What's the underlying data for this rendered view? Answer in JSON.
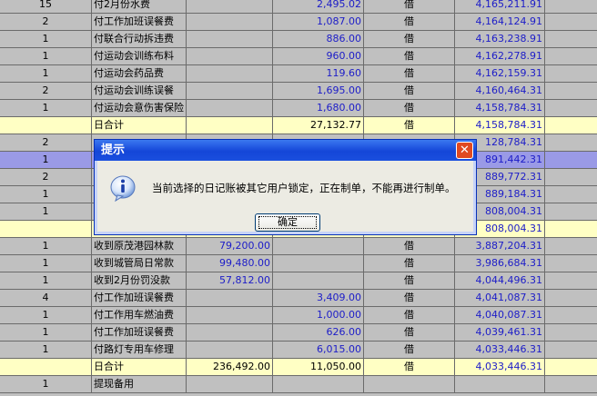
{
  "ledger": {
    "rows": [
      {
        "type": "normal",
        "count": "15",
        "summary": "付2月份水费",
        "debit": "",
        "credit": "2,495.02",
        "direction": "借",
        "balance": "4,165,211.91"
      },
      {
        "type": "normal",
        "count": "2",
        "summary": "付工作加班误餐费",
        "debit": "",
        "credit": "1,087.00",
        "direction": "借",
        "balance": "4,164,124.91"
      },
      {
        "type": "normal",
        "count": "1",
        "summary": "付联合行动拆违费",
        "debit": "",
        "credit": "886.00",
        "direction": "借",
        "balance": "4,163,238.91"
      },
      {
        "type": "normal",
        "count": "1",
        "summary": "付运动会训练布料",
        "debit": "",
        "credit": "960.00",
        "direction": "借",
        "balance": "4,162,278.91"
      },
      {
        "type": "normal",
        "count": "1",
        "summary": "付运动会药品费",
        "debit": "",
        "credit": "119.60",
        "direction": "借",
        "balance": "4,162,159.31"
      },
      {
        "type": "normal",
        "count": "2",
        "summary": "付运动会训练误餐",
        "debit": "",
        "credit": "1,695.00",
        "direction": "借",
        "balance": "4,160,464.31"
      },
      {
        "type": "normal",
        "count": "1",
        "summary": "付运动会意伤害保险",
        "debit": "",
        "credit": "1,680.00",
        "direction": "借",
        "balance": "4,158,784.31"
      },
      {
        "type": "total",
        "count": "",
        "summary": "日合计",
        "debit": "",
        "credit": "27,132.77",
        "direction": "借",
        "balance": "4,158,784.31"
      },
      {
        "type": "normal",
        "count": "2",
        "summary": "",
        "debit": "",
        "credit": "",
        "direction": "",
        "balance": "128,784.31"
      },
      {
        "type": "sel",
        "count": "1",
        "summary": "",
        "debit": "",
        "credit": "",
        "direction": "",
        "balance": "891,442.31"
      },
      {
        "type": "normal",
        "count": "2",
        "summary": "",
        "debit": "",
        "credit": "",
        "direction": "",
        "balance": "889,772.31"
      },
      {
        "type": "normal",
        "count": "1",
        "summary": "",
        "debit": "",
        "credit": "",
        "direction": "",
        "balance": "889,184.31"
      },
      {
        "type": "normal",
        "count": "1",
        "summary": "",
        "debit": "",
        "credit": "",
        "direction": "",
        "balance": "808,004.31"
      },
      {
        "type": "total",
        "count": "",
        "summary": "",
        "debit": "",
        "credit": "",
        "direction": "",
        "balance": "808,004.31"
      },
      {
        "type": "normal",
        "count": "1",
        "summary": "收到原茂港园林款",
        "debit": "79,200.00",
        "credit": "",
        "direction": "借",
        "balance": "3,887,204.31"
      },
      {
        "type": "normal",
        "count": "1",
        "summary": "收到城管局日常款",
        "debit": "99,480.00",
        "credit": "",
        "direction": "借",
        "balance": "3,986,684.31"
      },
      {
        "type": "normal",
        "count": "1",
        "summary": "收到2月份罚没款",
        "debit": "57,812.00",
        "credit": "",
        "direction": "借",
        "balance": "4,044,496.31"
      },
      {
        "type": "normal",
        "count": "4",
        "summary": "付工作加班误餐费",
        "debit": "",
        "credit": "3,409.00",
        "direction": "借",
        "balance": "4,041,087.31"
      },
      {
        "type": "normal",
        "count": "1",
        "summary": "付工作用车燃油费",
        "debit": "",
        "credit": "1,000.00",
        "direction": "借",
        "balance": "4,040,087.31"
      },
      {
        "type": "normal",
        "count": "1",
        "summary": "付工作加班误餐费",
        "debit": "",
        "credit": "626.00",
        "direction": "借",
        "balance": "4,039,461.31"
      },
      {
        "type": "normal",
        "count": "1",
        "summary": "付路灯专用车修理",
        "debit": "",
        "credit": "6,015.00",
        "direction": "借",
        "balance": "4,033,446.31"
      },
      {
        "type": "total",
        "count": "",
        "summary": "日合计",
        "debit": "236,492.00",
        "credit": "11,050.00",
        "direction": "借",
        "balance": "4,033,446.31"
      },
      {
        "type": "normal",
        "count": "1",
        "summary": "提现备用",
        "debit": "",
        "credit": "",
        "direction": "",
        "balance": ""
      }
    ]
  },
  "dialog": {
    "title": "提示",
    "close_glyph": "✕",
    "message": "当前选择的日记账被其它用户锁定，正在制单，不能再进行制单。",
    "ok_label": "确定",
    "icon": "info-icon"
  },
  "colors": {
    "grid_bg": "#c0c0c0",
    "total_row": "#ffffc4",
    "selected_row": "#9a9ae6",
    "amount_text": "#1c1cc8",
    "titlebar": "#1446d8",
    "close_button": "#e04a22"
  }
}
